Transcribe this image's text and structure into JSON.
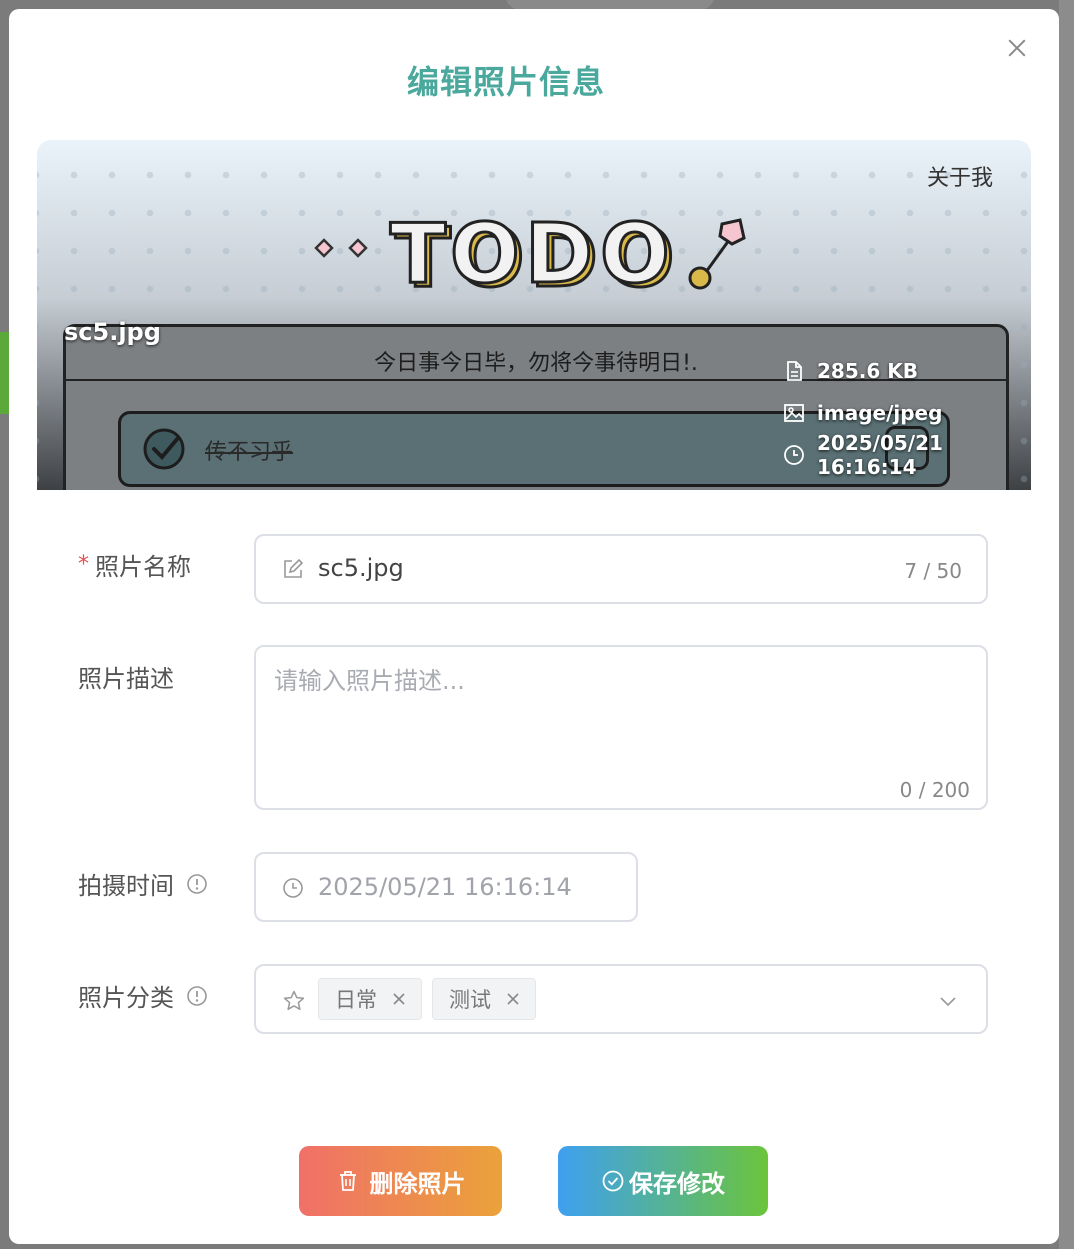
{
  "dialog": {
    "title": "编辑照片信息",
    "close_icon": "close-icon"
  },
  "preview": {
    "about_link": "关于我",
    "slogan": "今日事今日毕，勿将今事待明日!.",
    "todo_item_text": "传不习乎",
    "file_name": "sc5.jpg",
    "meta": {
      "size": "285.6 KB",
      "type": "image/jpeg",
      "time": "2025/05/21 16:16:14"
    }
  },
  "form": {
    "name": {
      "label": "照片名称",
      "required_mark": "*",
      "value": "sc5.jpg",
      "counter": "7 / 50"
    },
    "description": {
      "label": "照片描述",
      "placeholder": "请输入照片描述...",
      "counter": "0 / 200"
    },
    "capture_time": {
      "label": "拍摄时间",
      "value": "2025/05/21 16:16:14"
    },
    "category": {
      "label": "照片分类",
      "tags": [
        "日常",
        "测试"
      ]
    }
  },
  "actions": {
    "delete_label": "删除照片",
    "save_label": "保存修改"
  },
  "colors": {
    "title": "#4aa89c",
    "required": "#e0514f",
    "delete_gradient": [
      "#f07068",
      "#eba23a"
    ],
    "save_gradient": [
      "#3ea0f0",
      "#6cc43c"
    ]
  }
}
